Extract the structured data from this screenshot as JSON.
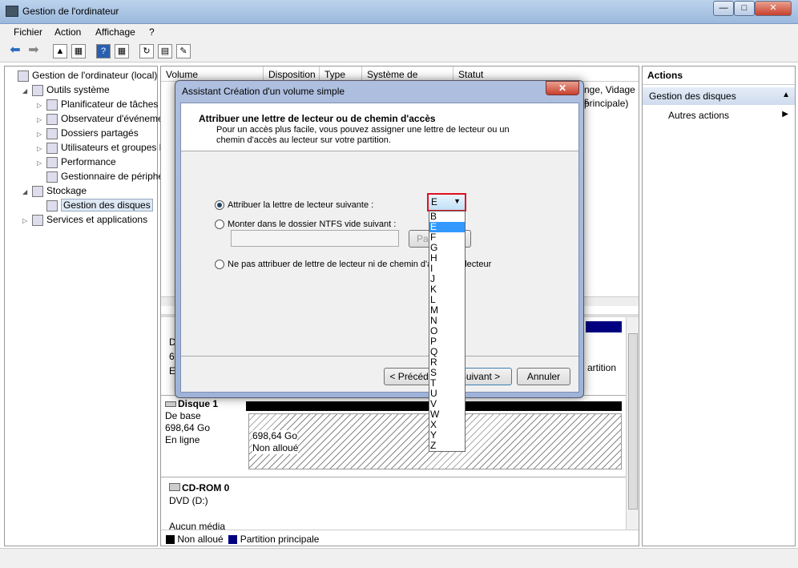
{
  "window": {
    "title": "Gestion de l'ordinateur",
    "min": "—",
    "max": "□",
    "close": "✕"
  },
  "menu": [
    "Fichier",
    "Action",
    "Affichage",
    "?"
  ],
  "tree": [
    {
      "label": "Gestion de l'ordinateur (local)",
      "level": 0,
      "exp": ""
    },
    {
      "label": "Outils système",
      "level": 1,
      "exp": "◢"
    },
    {
      "label": "Planificateur de tâches",
      "level": 2,
      "exp": "▷"
    },
    {
      "label": "Observateur d'événeme",
      "level": 2,
      "exp": "▷"
    },
    {
      "label": "Dossiers partagés",
      "level": 2,
      "exp": "▷"
    },
    {
      "label": "Utilisateurs et groupes l",
      "level": 2,
      "exp": "▷"
    },
    {
      "label": "Performance",
      "level": 2,
      "exp": "▷"
    },
    {
      "label": "Gestionnaire de périphé",
      "level": 2,
      "exp": ""
    },
    {
      "label": "Stockage",
      "level": 1,
      "exp": "◢"
    },
    {
      "label": "Gestion des disques",
      "level": 2,
      "exp": "",
      "selected": true
    },
    {
      "label": "Services et applications",
      "level": 1,
      "exp": "▷"
    }
  ],
  "columns": [
    "Volume",
    "Disposition",
    "Type",
    "Système de fichiers",
    "Statut"
  ],
  "list_fragments": [
    "nge, Vidage s",
    "principale)"
  ],
  "disk0_fragments": [
    "D",
    "69",
    "E",
    "artition"
  ],
  "disk1": {
    "name": "Disque 1",
    "type": "De base",
    "size": "698,64 Go",
    "status": "En ligne",
    "part_size": "698,64 Go",
    "part_label": "Non alloué"
  },
  "cdrom": {
    "name": "CD-ROM 0",
    "drive": "DVD (D:)",
    "status": "Aucun média"
  },
  "legend": [
    {
      "label": "Non alloué",
      "color": "#000000"
    },
    {
      "label": "Partition principale",
      "color": "#000080"
    }
  ],
  "actions": {
    "title": "Actions",
    "section": "Gestion des disques",
    "item": "Autres actions"
  },
  "dialog": {
    "title": "Assistant Création d'un volume simple",
    "heading": "Attribuer une lettre de lecteur ou de chemin d'accès",
    "desc": "Pour un accès plus facile, vous pouvez assigner une lettre de lecteur ou un chemin d'accès au lecteur sur votre partition.",
    "opt1": "Attribuer la lettre de lecteur suivante :",
    "opt2": "Monter dans le dossier NTFS vide suivant :",
    "opt3": "Ne pas attribuer de lettre de lecteur ni de chemin d'accès au lecteur",
    "browse": "Parcourir...",
    "selected_letter": "E",
    "letters": [
      "B",
      "E",
      "F",
      "G",
      "H",
      "I",
      "J",
      "K",
      "L",
      "M",
      "N",
      "O",
      "P",
      "Q",
      "R",
      "S",
      "T",
      "U",
      "V",
      "W",
      "X",
      "Y",
      "Z"
    ],
    "back": "< Précédent",
    "next": "Suivant >",
    "cancel": "Annuler"
  }
}
